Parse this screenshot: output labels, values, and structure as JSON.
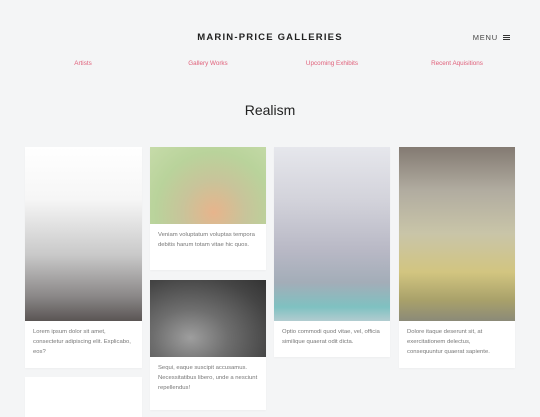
{
  "brand": "MARIN-PRICE GALLERIES",
  "menu_label": "MENU",
  "nav": [
    "Artists",
    "Gallery Works",
    "Upcoming Exhibits",
    "Recent Aquisitions"
  ],
  "heading": "Realism",
  "cards": [
    {
      "caption": "Lorem ipsum dolor sit amet, consectetur adipiscing elit. Explicabo, eos?"
    },
    {
      "caption": "Veniam voluptatum voluptas tempora debitis harum totam vitae hic quos."
    },
    {
      "caption": "Sequi, eaque suscipit accusamus. Necessitatibus libero, unde a nesciunt repellendus!"
    },
    {
      "caption": "Optio commodi quod vitae, vel, officia similique quaerat odit dicta."
    },
    {
      "caption": "Dolore itaque deserunt sit, at exercitationem delectus, consequuntur quaerat sapiente."
    }
  ],
  "colors": {
    "accent": "#e0607a",
    "background": "#f4f5f6"
  }
}
